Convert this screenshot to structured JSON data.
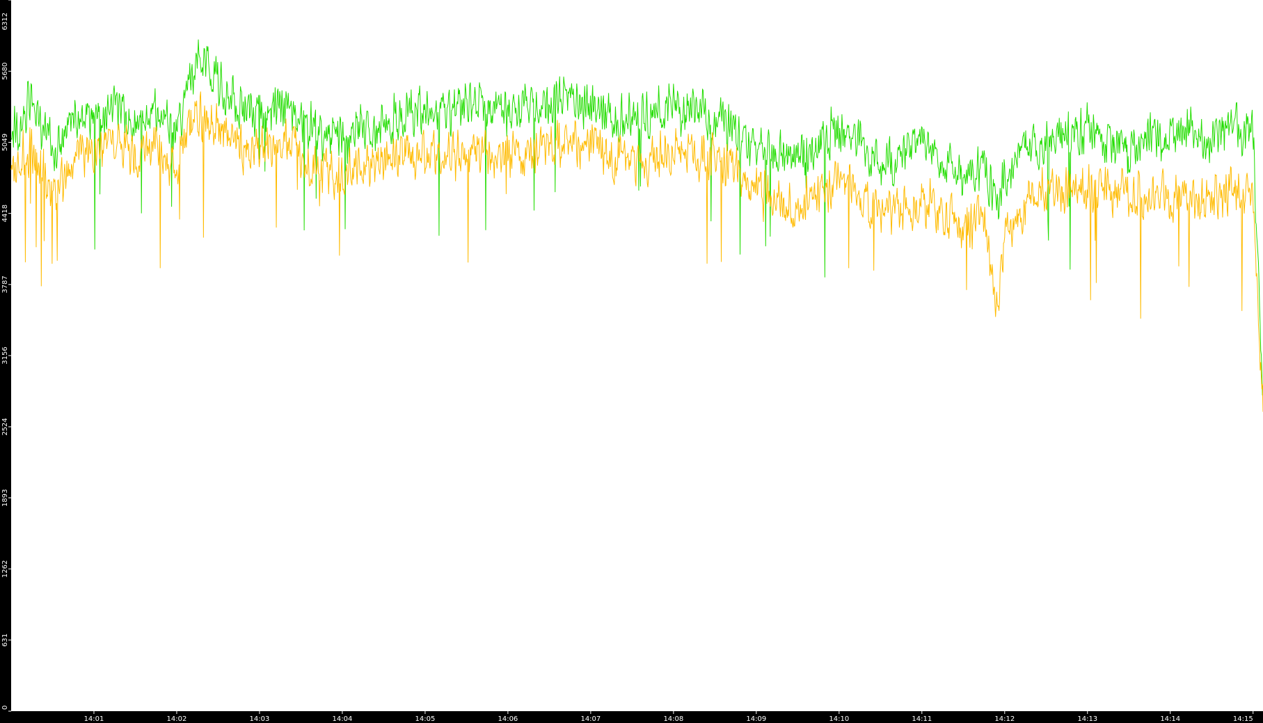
{
  "chart_data": {
    "type": "line",
    "title": "",
    "xlabel": "",
    "ylabel": "",
    "ylim": [
      0,
      6312
    ],
    "xlim_minutes": [
      0,
      15.12
    ],
    "grid": false,
    "legend": "none",
    "background_color": "#ffffff",
    "frame_color": "#000000",
    "y_ticks": [
      "0",
      "631",
      "1262",
      "1893",
      "2524",
      "3156",
      "3787",
      "4418",
      "5049",
      "5680",
      "6312"
    ],
    "y_tick_values": [
      0,
      631,
      1262,
      1893,
      2524,
      3156,
      3787,
      4418,
      5049,
      5680,
      6312
    ],
    "x_ticks": [
      "14:01",
      "14:02",
      "14:03",
      "14:04",
      "14:05",
      "14:06",
      "14:07",
      "14:08",
      "14:09",
      "14:10",
      "14:11",
      "14:12",
      "14:13",
      "14:14",
      "14:15"
    ],
    "x_tick_values": [
      1,
      2,
      3,
      4,
      5,
      6,
      7,
      8,
      9,
      10,
      11,
      12,
      13,
      14,
      15
    ],
    "series": [
      {
        "color": "#22dd00",
        "x_minutes": [
          0,
          0.25,
          0.5,
          0.75,
          1,
          1.25,
          1.5,
          1.75,
          2,
          2.25,
          2.5,
          2.75,
          3,
          3.25,
          3.5,
          3.75,
          4,
          4.25,
          4.5,
          4.75,
          5,
          5.25,
          5.5,
          5.75,
          6,
          6.25,
          6.5,
          6.75,
          7,
          7.25,
          7.5,
          7.75,
          8,
          8.25,
          8.5,
          8.75,
          9,
          9.25,
          9.5,
          9.75,
          10,
          10.25,
          10.5,
          10.75,
          11,
          11.25,
          11.5,
          11.75,
          11.9,
          12,
          12.25,
          12.5,
          12.75,
          13,
          13.25,
          13.5,
          13.75,
          14,
          14.25,
          14.5,
          14.75,
          15,
          15.12
        ],
        "values": [
          5100,
          5400,
          5000,
          5200,
          5300,
          5350,
          5250,
          5300,
          5150,
          5800,
          5600,
          5350,
          5300,
          5350,
          5250,
          5100,
          5050,
          5150,
          5200,
          5300,
          5350,
          5300,
          5400,
          5350,
          5300,
          5350,
          5400,
          5450,
          5400,
          5300,
          5250,
          5300,
          5350,
          5300,
          5250,
          5150,
          5000,
          4950,
          4900,
          5050,
          5150,
          5000,
          4850,
          4950,
          5050,
          4850,
          4750,
          4850,
          4500,
          4750,
          5000,
          5050,
          5100,
          5150,
          5050,
          5000,
          5100,
          5100,
          5150,
          5050,
          5200,
          5150,
          2800
        ]
      },
      {
        "color": "#ffbb00",
        "x_minutes": [
          0,
          0.25,
          0.5,
          0.75,
          1,
          1.25,
          1.5,
          1.75,
          2,
          2.25,
          2.5,
          2.75,
          3,
          3.25,
          3.5,
          3.75,
          4,
          4.25,
          4.5,
          4.75,
          5,
          5.25,
          5.5,
          5.75,
          6,
          6.25,
          6.5,
          6.75,
          7,
          7.25,
          7.5,
          7.75,
          8,
          8.25,
          8.5,
          8.75,
          9,
          9.25,
          9.5,
          9.75,
          10,
          10.25,
          10.5,
          10.75,
          11,
          11.25,
          11.5,
          11.75,
          11.9,
          12,
          12.25,
          12.5,
          12.75,
          13,
          13.25,
          13.5,
          13.75,
          14,
          14.25,
          14.5,
          14.75,
          15,
          15.12
        ],
        "values": [
          4800,
          5000,
          4600,
          4900,
          5000,
          5050,
          4950,
          5000,
          4850,
          5300,
          5200,
          5000,
          4950,
          5050,
          4950,
          4800,
          4750,
          4850,
          4900,
          4950,
          4950,
          4900,
          4950,
          4950,
          4900,
          4950,
          5000,
          5050,
          5000,
          4900,
          4850,
          4900,
          4950,
          4950,
          4900,
          4800,
          4600,
          4550,
          4450,
          4600,
          4700,
          4550,
          4400,
          4450,
          4550,
          4400,
          4300,
          4350,
          3600,
          4200,
          4500,
          4600,
          4650,
          4650,
          4600,
          4550,
          4600,
          4550,
          4600,
          4500,
          4650,
          4600,
          2600
        ]
      }
    ]
  }
}
